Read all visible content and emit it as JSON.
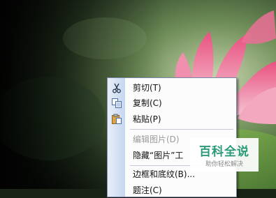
{
  "context_menu": {
    "items": [
      {
        "label": "剪切(T)",
        "icon": "scissors-icon",
        "enabled": true
      },
      {
        "label": "复制(C)",
        "icon": "copy-icon",
        "enabled": true
      },
      {
        "label": "粘贴(P)",
        "icon": "paste-icon",
        "enabled": true
      },
      {
        "label": "编辑图片(D)",
        "enabled": false
      },
      {
        "label": "隐藏“图片”工",
        "enabled": true
      },
      {
        "label": "边框和底纹(B)...",
        "enabled": true
      },
      {
        "label": "题注(C)",
        "enabled": true
      }
    ]
  },
  "watermark": {
    "title": "百科全说",
    "subtitle": "助你轻松解决"
  }
}
